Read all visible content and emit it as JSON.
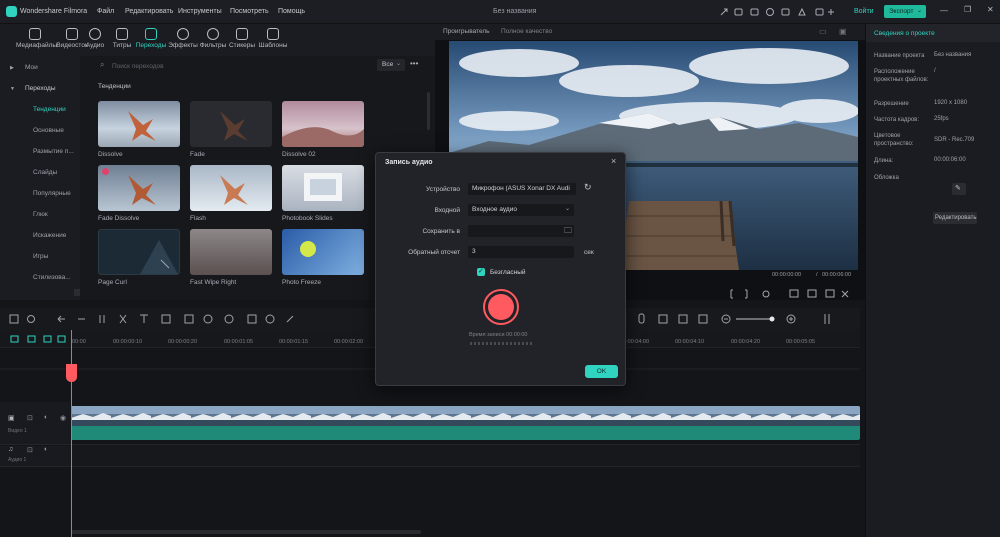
{
  "app": {
    "name": "Wondershare Filmora",
    "project_title": "Без названия",
    "menu": [
      "Файл",
      "Редактировать",
      "Инструменты",
      "Посмотреть",
      "Помощь"
    ],
    "login_label": "Войти",
    "export_label": "Экспорт"
  },
  "tabs": [
    "Медиафайлы",
    "Видеосток",
    "Аудио",
    "Титры",
    "Переходы",
    "Эффекты",
    "Фильтры",
    "Стикеры",
    "Шаблоны"
  ],
  "sidebar": {
    "items": [
      "Мои",
      "Переходы",
      "Тенденции",
      "Основные",
      "Размытие п...",
      "Слайды",
      "Популярные",
      "Глюк",
      "Искажение",
      "Игры",
      "Стилизова..."
    ]
  },
  "library": {
    "search_placeholder": "Поиск переходов",
    "filter_label": "Все",
    "section_title": "Тенденции",
    "items": [
      "Dissolve",
      "Fade",
      "Dissolve 02",
      "Fade Dissolve",
      "Flash",
      "Photobook Slides",
      "Page Curl",
      "Fast Wipe Right",
      "Photo Freeze"
    ]
  },
  "preview": {
    "player_label": "Проигрыватель",
    "quality_label": "Полное качество",
    "current_time": "00:00:00:00",
    "total_time": "00:00:06:00",
    "time_separator": "/"
  },
  "properties": {
    "tab_label": "Сведения о проекте",
    "rows": [
      {
        "label": "Название проекта",
        "value": "Без названия"
      },
      {
        "label": "Расположение проектных файлов:",
        "value": "/"
      },
      {
        "label": "Разрешение",
        "value": "1920 x 1080"
      },
      {
        "label": "Частота кадров:",
        "value": "25fps"
      },
      {
        "label": "Цветовое пространство:",
        "value": "SDR - Rec.709"
      },
      {
        "label": "Длина:",
        "value": "00:00:06:00"
      },
      {
        "label": "Обложка",
        "value": ""
      }
    ],
    "edit_label": "Редактировать"
  },
  "timeline": {
    "ruler": [
      "00:00",
      "00:00:00:10",
      "00:00:00:20",
      "00:00:01:05",
      "00:00:01:15",
      "00:00:02:00",
      "00:00:04:00",
      "00:00:04:10",
      "00:00:04:20",
      "00:00:05:05"
    ],
    "tracks": [
      "Видео 1",
      "Аудио 1"
    ]
  },
  "dialog": {
    "title": "Запись аудио",
    "device_label": "Устройство",
    "device_value": "Микрофон (ASUS Xonar DX Audio)",
    "input_label": "Входной",
    "input_value": "Входное аудио",
    "save_label": "Сохранить в",
    "countdown_label": "Обратный отсчет",
    "countdown_value": "3",
    "countdown_unit": "сек",
    "mute_label": "Безгласный",
    "record_time": "Время записи 00:00:00",
    "ok_label": "OK"
  },
  "colors": {
    "accent": "#2fd3c0",
    "record": "#ff5a5f",
    "export": "#1fb99b"
  }
}
